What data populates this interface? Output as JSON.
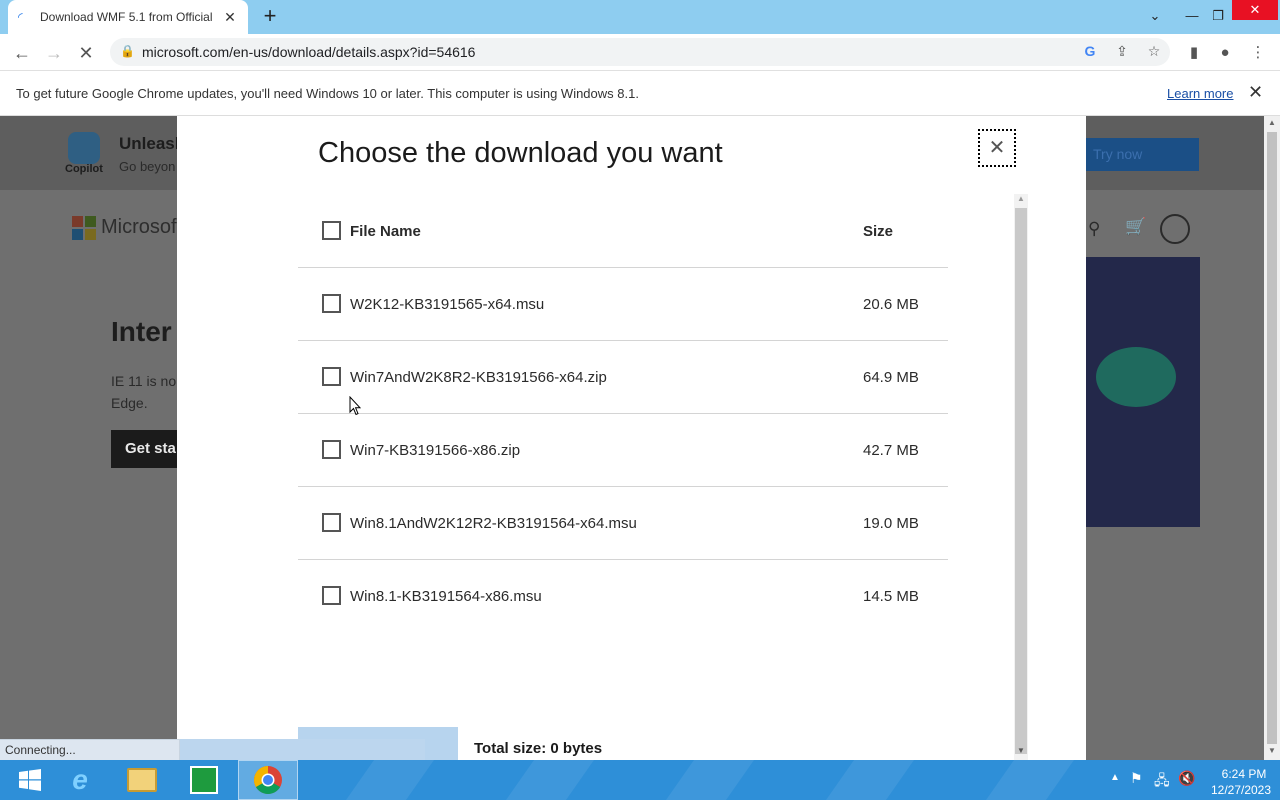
{
  "browser": {
    "tab_title": "Download WMF 5.1 from Official",
    "new_tab_symbol": "+",
    "url": "microsoft.com/en-us/download/details.aspx?id=54616",
    "status_text": "Connecting..."
  },
  "infobar": {
    "message": "To get future Google Chrome updates, you'll need Windows 10 or later. This computer is using Windows 8.1.",
    "learn_more": "Learn more"
  },
  "page_behind": {
    "copilot_label": "Copilot",
    "banner_title": "Unleash",
    "banner_sub": "Go beyon",
    "try_now": "Try now",
    "ms_brand": "Microsoft",
    "heading": "Inter",
    "body_line1": "IE 11 is no",
    "body_line2": "Edge.",
    "get_started": "Get sta"
  },
  "modal": {
    "title": "Choose the download you want",
    "header_name": "File Name",
    "header_size": "Size",
    "files": [
      {
        "name": "W2K12-KB3191565-x64.msu",
        "size": "20.6 MB"
      },
      {
        "name": "Win7AndW2K8R2-KB3191566-x64.zip",
        "size": "64.9 MB"
      },
      {
        "name": "Win7-KB3191566-x86.zip",
        "size": "42.7 MB"
      },
      {
        "name": "Win8.1AndW2K12R2-KB3191564-x64.msu",
        "size": "19.0 MB"
      },
      {
        "name": "Win8.1-KB3191564-x86.msu",
        "size": "14.5 MB"
      }
    ],
    "total_size": "Total size: 0 bytes"
  },
  "taskbar": {
    "time": "6:24 PM",
    "date": "12/27/2023"
  },
  "colors": {
    "taskbar": "#2e8fd8",
    "tabstrip": "#8ecdf0",
    "next_button": "#b7d4ee",
    "link": "#1a4fa5"
  }
}
